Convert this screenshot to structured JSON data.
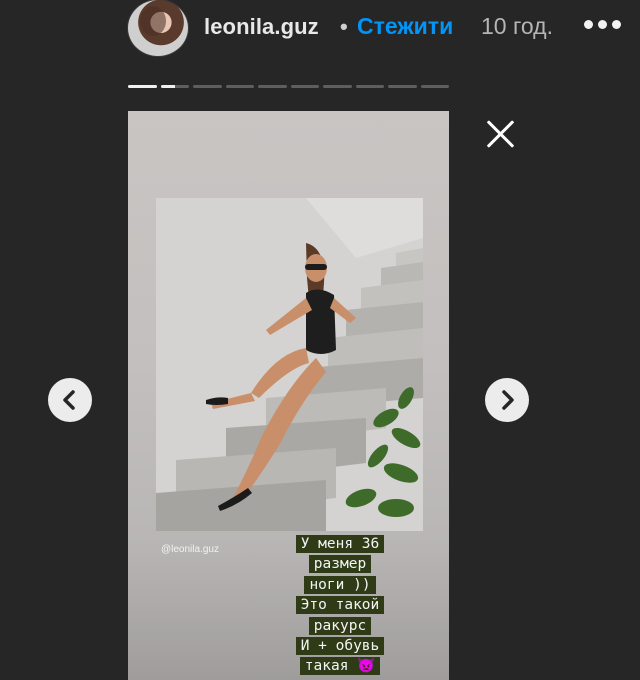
{
  "header": {
    "username": "leonila.guz",
    "separator": "•",
    "follow_label": "Стежити",
    "time": "10 год."
  },
  "progress": {
    "total_segments": 10,
    "current": 2,
    "current_fill": 0.5
  },
  "story": {
    "credit": "@leonila.guz",
    "caption_lines": [
      "У меня 36",
      "размер",
      "ноги ))",
      "Это такой",
      "ракурс",
      "И + обувь",
      "такая 👿"
    ]
  },
  "icons": {
    "avatar": "profile-photo",
    "more": "more-dots-icon",
    "close": "close-icon",
    "prev": "chevron-left-icon",
    "next": "chevron-right-icon"
  },
  "colors": {
    "background": "#262626",
    "follow": "#0095f6",
    "caption_bg": "#2f3b16"
  }
}
